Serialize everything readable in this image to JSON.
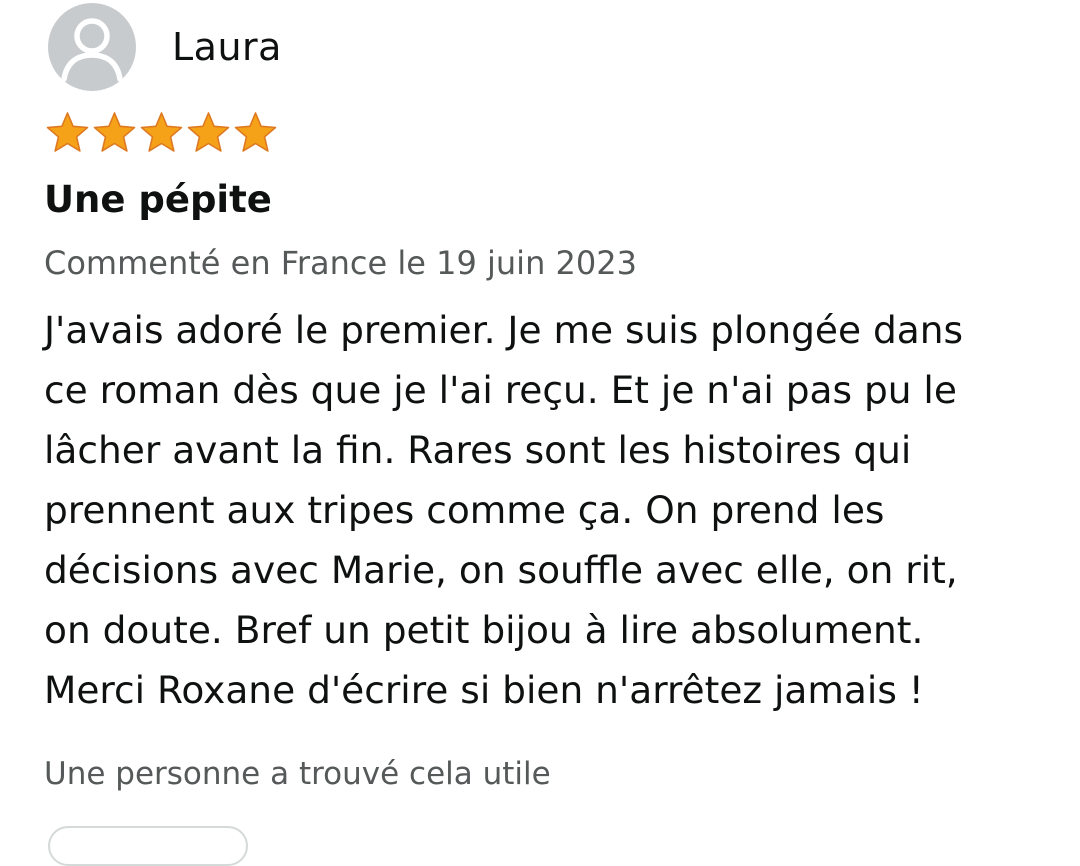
{
  "reviewer": {
    "name": "Laura",
    "avatar_icon": "user-silhouette-icon"
  },
  "rating": {
    "value": 5,
    "max": 5,
    "star_color": "#f6a219",
    "star_icon": "star-icon"
  },
  "review": {
    "title": "Une pépite",
    "date": "Commenté en France le 19 juin 2023",
    "body_lines": [
      "J'avais adoré le premier. Je me suis plongée dans",
      "ce roman dès que je l'ai reçu. Et je n'ai pas pu le",
      "lâcher avant la fin. Rares sont les histoires qui",
      "prennent aux tripes comme ça. On prend les",
      "décisions avec Marie, on souffle avec elle, on rit,",
      "on doute. Bref un petit bijou à lire absolument.",
      "Merci Roxane d'écrire si bien n'arrêtez jamais !"
    ]
  },
  "helpful": {
    "text": "Une personne a trouvé cela utile"
  }
}
